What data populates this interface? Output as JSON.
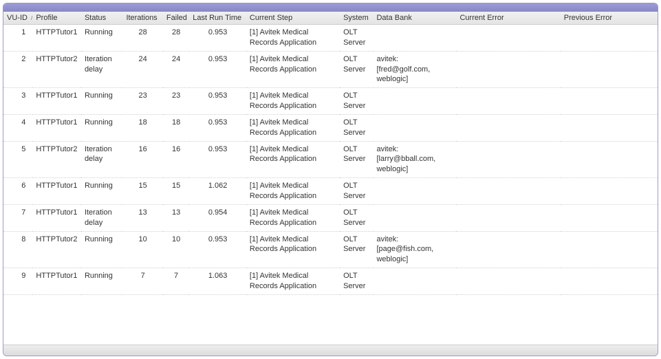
{
  "columns": {
    "vuid": "VU-ID",
    "profile": "Profile",
    "status": "Status",
    "iterations": "Iterations",
    "failed": "Failed",
    "last_run_time": "Last Run Time",
    "current_step": "Current Step",
    "system": "System",
    "data_bank": "Data Bank",
    "current_error": "Current Error",
    "previous_error": "Previous Error"
  },
  "sort_indicator": "/",
  "rows": [
    {
      "vuid": "1",
      "profile": "HTTPTutor1",
      "status": "Running",
      "iterations": "28",
      "failed": "28",
      "last_run_time": "0.953",
      "current_step": "[1] Avitek Medical Records Application",
      "system": "OLT Server",
      "data_bank": "",
      "current_error": "",
      "previous_error": ""
    },
    {
      "vuid": "2",
      "profile": "HTTPTutor2",
      "status": "Iteration delay",
      "iterations": "24",
      "failed": "24",
      "last_run_time": "0.953",
      "current_step": "[1] Avitek Medical Records Application",
      "system": "OLT Server",
      "data_bank": "avitek: [fred@golf.com, weblogic]",
      "current_error": "",
      "previous_error": ""
    },
    {
      "vuid": "3",
      "profile": "HTTPTutor1",
      "status": "Running",
      "iterations": "23",
      "failed": "23",
      "last_run_time": "0.953",
      "current_step": "[1] Avitek Medical Records Application",
      "system": "OLT Server",
      "data_bank": "",
      "current_error": "",
      "previous_error": ""
    },
    {
      "vuid": "4",
      "profile": "HTTPTutor1",
      "status": "Running",
      "iterations": "18",
      "failed": "18",
      "last_run_time": "0.953",
      "current_step": "[1] Avitek Medical Records Application",
      "system": "OLT Server",
      "data_bank": "",
      "current_error": "",
      "previous_error": ""
    },
    {
      "vuid": "5",
      "profile": "HTTPTutor2",
      "status": "Iteration delay",
      "iterations": "16",
      "failed": "16",
      "last_run_time": "0.953",
      "current_step": "[1] Avitek Medical Records Application",
      "system": "OLT Server",
      "data_bank": "avitek: [larry@bball.com, weblogic]",
      "current_error": "",
      "previous_error": ""
    },
    {
      "vuid": "6",
      "profile": "HTTPTutor1",
      "status": "Running",
      "iterations": "15",
      "failed": "15",
      "last_run_time": "1.062",
      "current_step": "[1] Avitek Medical Records Application",
      "system": "OLT Server",
      "data_bank": "",
      "current_error": "",
      "previous_error": ""
    },
    {
      "vuid": "7",
      "profile": "HTTPTutor1",
      "status": "Iteration delay",
      "iterations": "13",
      "failed": "13",
      "last_run_time": "0.954",
      "current_step": "[1] Avitek Medical Records Application",
      "system": "OLT Server",
      "data_bank": "",
      "current_error": "",
      "previous_error": ""
    },
    {
      "vuid": "8",
      "profile": "HTTPTutor2",
      "status": "Running",
      "iterations": "10",
      "failed": "10",
      "last_run_time": "0.953",
      "current_step": "[1] Avitek Medical Records Application",
      "system": "OLT Server",
      "data_bank": "avitek: [page@fish.com, weblogic]",
      "current_error": "",
      "previous_error": ""
    },
    {
      "vuid": "9",
      "profile": "HTTPTutor1",
      "status": "Running",
      "iterations": "7",
      "failed": "7",
      "last_run_time": "1.063",
      "current_step": "[1] Avitek Medical Records Application",
      "system": "OLT Server",
      "data_bank": "",
      "current_error": "",
      "previous_error": ""
    }
  ]
}
